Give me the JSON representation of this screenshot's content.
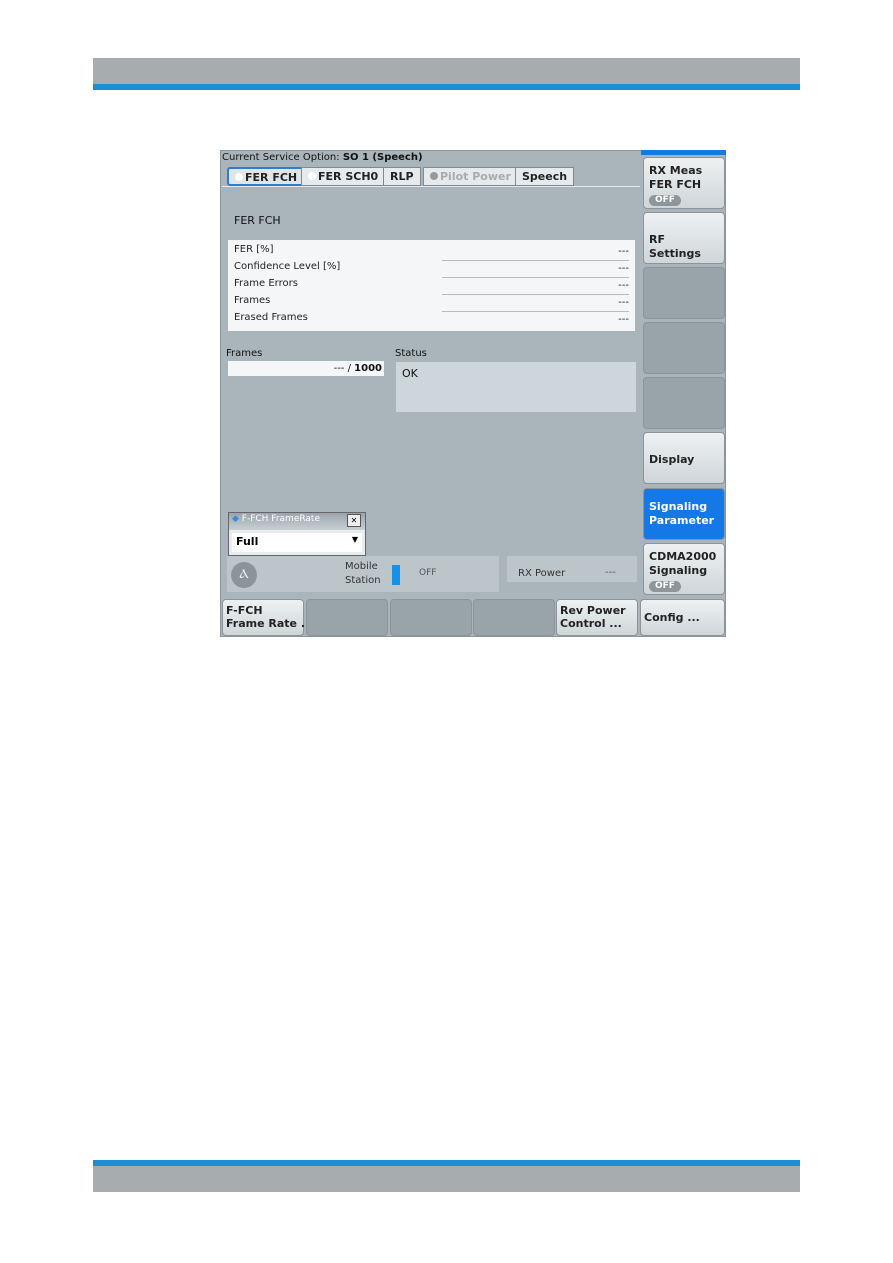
{
  "service_option": {
    "label": "Current Service Option:",
    "value": "SO 1 (Speech)"
  },
  "tabs": [
    {
      "label": "FER FCH"
    },
    {
      "label": "FER SCH0"
    },
    {
      "label": "RLP"
    },
    {
      "label": "Pilot Power"
    },
    {
      "label": "Speech"
    }
  ],
  "section_title": "FER FCH",
  "results": [
    {
      "label": "FER [%]",
      "value": "---"
    },
    {
      "label": "Confidence Level [%]",
      "value": "---"
    },
    {
      "label": "Frame Errors",
      "value": "---"
    },
    {
      "label": "Frames",
      "value": "---"
    },
    {
      "label": "Erased Frames",
      "value": "---"
    }
  ],
  "frames": {
    "label": "Frames",
    "value": "--- / ",
    "total": "1000"
  },
  "status": {
    "label": "Status",
    "value": "OK"
  },
  "popup": {
    "title": "F-FCH FrameRate",
    "close": "✕",
    "value": "Full"
  },
  "mobile": {
    "label1": "Mobile",
    "label2": "Station",
    "state": "OFF"
  },
  "rx_power": {
    "label": "RX Power",
    "value": "---"
  },
  "softkeys": [
    {
      "l1": "RX Meas",
      "l2": "FER FCH",
      "pill": "OFF"
    },
    {
      "l1": "RF Settings"
    },
    {},
    {},
    {},
    {
      "l1": "Display"
    },
    {
      "l1": "Signaling",
      "l2": "Parameter"
    },
    {
      "l1": "CDMA2000",
      "l2": "Signaling",
      "pill": "OFF"
    }
  ],
  "bottom_keys": [
    {
      "l1": "F-FCH",
      "l2": "Frame Rate ..."
    },
    {},
    {},
    {},
    {
      "l1": "Rev Power",
      "l2": "Control ..."
    },
    {
      "l1": "Config ..."
    }
  ],
  "colors": {
    "accent": "#1478e6",
    "stripe": "#1a8fd6"
  }
}
